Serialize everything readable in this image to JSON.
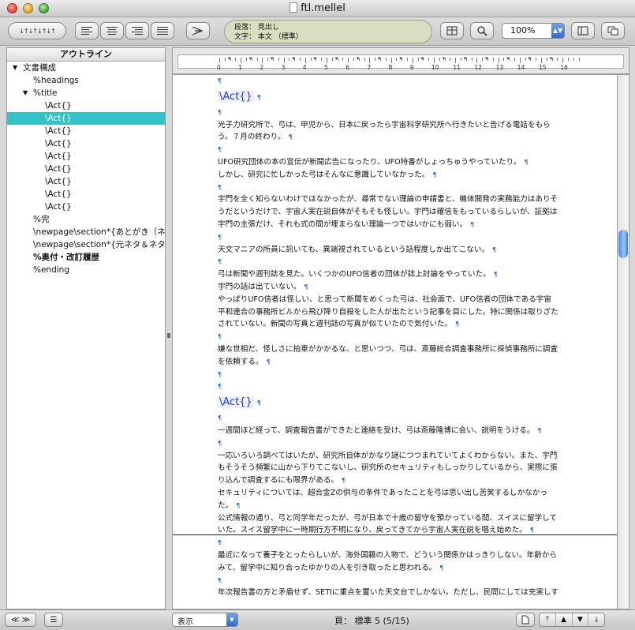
{
  "window": {
    "title": "ftl.mellel"
  },
  "toolbar": {
    "style_info_line1": "段落： 見出し",
    "style_info_line2": "文字： 本文 （標準）",
    "zoom": "100%",
    "tab_stops_label": "↓↑↓↑↓↑↓↑"
  },
  "sidebar": {
    "header": "アウトライン",
    "items": [
      {
        "label": "文書構成",
        "level": 0,
        "disclosure": "open"
      },
      {
        "label": "%headings",
        "level": 1
      },
      {
        "label": "%title",
        "level": 1,
        "disclosure": "open"
      },
      {
        "label": "\\Act{}",
        "level": 2
      },
      {
        "label": "\\Act{}",
        "level": 2,
        "selected": true
      },
      {
        "label": "\\Act{}",
        "level": 2
      },
      {
        "label": "\\Act{}",
        "level": 2
      },
      {
        "label": "\\Act{}",
        "level": 2
      },
      {
        "label": "\\Act{}",
        "level": 2
      },
      {
        "label": "\\Act{}",
        "level": 2
      },
      {
        "label": "\\Act{}",
        "level": 2
      },
      {
        "label": "\\Act{}",
        "level": 2
      },
      {
        "label": "%完",
        "level": 1
      },
      {
        "label": "\\newpage\\section*{あとがき（ネ",
        "level": 1,
        "bold_tail": true
      },
      {
        "label": "\\newpage\\section*{元ネタ＆ネタ",
        "level": 1,
        "bold_tail": true
      },
      {
        "label": "%奥付・改訂履歴",
        "level": 1,
        "bold": true
      },
      {
        "label": "%ending",
        "level": 1
      }
    ]
  },
  "ruler": {
    "numbers": [
      "0",
      "1",
      "2",
      "3",
      "4",
      "5",
      "6",
      "7",
      "8",
      "9",
      "10",
      "11",
      "12",
      "13",
      "14",
      "15",
      "16"
    ]
  },
  "document": {
    "pilcrow": "¶",
    "heading_text": "\\Act{}",
    "lines": [
      {
        "type": "empty"
      },
      {
        "type": "heading"
      },
      {
        "type": "empty"
      },
      {
        "type": "text",
        "text": "光子力研究所で、弓は、甲児から、日本に戻ったら宇宙科学研究所へ行きたいと告げる電話をもら"
      },
      {
        "type": "text",
        "text": "う。７月の終わり。",
        "end": true
      },
      {
        "type": "empty"
      },
      {
        "type": "text",
        "text": "UFO研究団体の本の宣伝が新聞広告になったり、UFO特番がしょっちゅうやっていたり。",
        "end": true
      },
      {
        "type": "text",
        "text": "しかし、研究に忙しかった弓はそんなに意識していなかった。",
        "end": true
      },
      {
        "type": "empty"
      },
      {
        "type": "text",
        "text": "宇門を全く知らないわけではなかったが、尋常でない理論の申請書と、機体開発の実務能力はありそ"
      },
      {
        "type": "text",
        "text": "うだというだけで、宇宙人実在説自体がそもそも怪しい。宇門は確信をもっているらしいが、証拠は"
      },
      {
        "type": "text",
        "text": "宇門の主張だけ、それも式の間が埋まらない理論一つではいかにも弱い。",
        "end": true
      },
      {
        "type": "empty"
      },
      {
        "type": "text",
        "text": "天文マニアの所員に訊いても、異端視されているという話程度しか出てこない。",
        "end": true
      },
      {
        "type": "empty"
      },
      {
        "type": "text",
        "text": "弓は新聞や週刊誌を見た。いくつかのUFO信者の団体が誌上討論をやっていた。",
        "end": true
      },
      {
        "type": "text",
        "text": "宇門の話は出ていない。",
        "end": true
      },
      {
        "type": "text",
        "text": "やっぱりUFO信者は怪しい、と思って新聞をめくった弓は、社会面で、UFO信者の団体である宇宙"
      },
      {
        "type": "text",
        "text": "平和連合の事務所ビルから飛び降り自殺をした人が出たという記事を目にした。特に関係は取りざた"
      },
      {
        "type": "text",
        "text": "されていない。新聞の写真と週刊誌の写真が似ていたので気付いた。",
        "end": true
      },
      {
        "type": "empty"
      },
      {
        "type": "text",
        "text": "嫌な世相だ、怪しさに拍車がかかるな、と思いつつ、弓は、斎藤総合調査事務所に探偵事務所に調査"
      },
      {
        "type": "text",
        "text": "を依頼する。",
        "end": true
      },
      {
        "type": "empty"
      },
      {
        "type": "empty"
      },
      {
        "type": "heading"
      },
      {
        "type": "empty"
      },
      {
        "type": "text",
        "text": "一週間ほど経って、調査報告書ができたと連絡を受け、弓は斎藤隆博に会い、説明をうける。",
        "end": true
      },
      {
        "type": "empty"
      },
      {
        "type": "text",
        "text": "一応いろいろ調べてはいたが、研究所自体がかなり謎につつまれていてよくわからない。また、宇門"
      },
      {
        "type": "text",
        "text": "もそうそう頻繁に山から下りてこないし、研究所のセキュリティもしっかりしているから、実際に張"
      },
      {
        "type": "text",
        "text": "り込んで調査するにも限界がある。",
        "end": true
      },
      {
        "type": "text",
        "text": "セキュリティについては、超合金Zの供与の条件であったことを弓は思い出し苦笑するしかなかっ"
      },
      {
        "type": "text",
        "text": "た。",
        "end": true
      },
      {
        "type": "text",
        "text": "公式情報の通り、弓と同学年だったが、弓が日本で十歳の留守を預かっている間、スイスに留学して"
      },
      {
        "type": "text",
        "text": "いた。スイス留学中に一時期行方不明になり、戻ってきてから宇宙人実在説を唱え始めた。",
        "end": true
      },
      {
        "type": "empty"
      },
      {
        "type": "text",
        "text": "最近になって養子をとったらしいが、海外国籍の人物で、どういう関係かはっきりしない。年齢から"
      },
      {
        "type": "text",
        "text": "みて、留学中に知り合ったゆかりの人を引き取ったと思われる。",
        "end": true
      },
      {
        "type": "empty"
      },
      {
        "type": "text",
        "text": "年次報告書の方と矛盾せず、SETIに重点を置いた天文台でしかない。ただし、民間にしては充実しす"
      }
    ]
  },
  "statusbar": {
    "view_label": "表示",
    "page_info": "頁： 標準 5 (5/15)"
  }
}
